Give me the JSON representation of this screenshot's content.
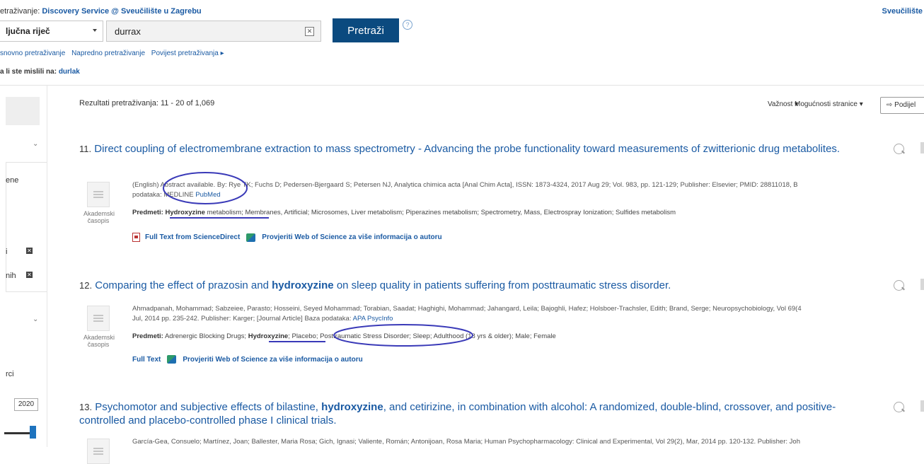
{
  "header": {
    "searching_label": "etraživanje:",
    "searching_value": "Discovery Service @ Sveučilište u Zagrebu",
    "institution": "Sveučilište",
    "field_select": "ljučna riječ",
    "query": "durrax",
    "search_button": "Pretraži",
    "help": "?",
    "nav": [
      "snovno pretraživanje",
      "Napredno pretraživanje",
      "Povijest pretraživanja ▸"
    ],
    "did_you_mean_label": "a li ste mislili na:",
    "did_you_mean_value": "durlak"
  },
  "sidebar": {
    "label_ene": "ene",
    "label_i": "i",
    "label_nih": "nih",
    "label_rci": "rci",
    "year": "2020",
    "remove": "✕"
  },
  "results": {
    "summary": "Rezultati pretraživanja: 11 - 20 of 1,069",
    "sort": "Važnost ▾",
    "page_options": "Mogućnosti stranice ▾",
    "share": "Podijel",
    "records": [
      {
        "number": "11.",
        "title": "Direct coupling of electromembrane extraction to mass spectrometry - Advancing the probe functionality toward measurements of zwitterionic drug metabolites.",
        "meta_line1": "(English) Abstract available. By: Rye TK; Fuchs D; Pedersen-Bjergaard S; Petersen NJ, Analytica chimica acta [Anal Chim Acta], ISSN: 1873-4324, 2017 Aug 29; Vol. 983, pp. 121-129; Publisher: Elsevier; PMID: 28811018, B",
        "meta_line2_prefix": "podataka: MEDLINE",
        "db": "PubMed",
        "subjects_label": "Predmeti:",
        "subjects_hl": "Hydroxyzine",
        "subjects_rest": " metabolism; Membranes, Artificial; Microsomes, Liver metabolism; Piperazines metabolism; Spectrometry, Mass, Electrospray Ionization; Sulfides metabolism",
        "type_label1": "Akademski",
        "type_label2": "časopis",
        "link1": "Full Text from ScienceDirect",
        "link2": "Provjeriti Web of Science za više informacija o autoru"
      },
      {
        "number": "12.",
        "title_pre": "Comparing the effect of prazosin and ",
        "title_hl": "hydroxyzine",
        "title_post": " on sleep quality in patients suffering from posttraumatic stress disorder.",
        "meta_line1": "Ahmadpanah, Mohammad; Sabzeiee, Parasto; Hosseini, Seyed Mohammad; Torabian, Saadat; Haghighi, Mohammad; Jahangard, Leila; Bajoghli, Hafez; Holsboer-Trachsler, Edith; Brand, Serge; Neuropsychobiology, Vol 69(4",
        "meta_line2_prefix": "Jul, 2014 pp. 235-242. Publisher: Karger; [Journal Article] Baza podataka:",
        "db": "APA PsycInfo",
        "subjects_label": "Predmeti:",
        "subjects_pre": " Adrenergic Blocking Drugs; ",
        "subjects_hl": "Hydroxyzine",
        "subjects_rest": "; Placebo; Posttraumatic Stress Disorder; Sleep; Adulthood (18 yrs & older); Male; Female",
        "type_label1": "Akademski",
        "type_label2": "časopis",
        "link1": "Full Text",
        "link2": "Provjeriti Web of Science za više informacija o autoru"
      },
      {
        "number": "13.",
        "title_pre": "Psychomotor and subjective effects of bilastine, ",
        "title_hl": "hydroxyzine",
        "title_post": ", and cetirizine, in combination with alcohol: A randomized, double-blind, crossover, and positive-controlled and placebo-controlled phase I clinical trials.",
        "meta_line1": "García-Gea, Consuelo; Martínez, Joan; Ballester, Maria Rosa; Gich, Ignasi; Valiente, Román; Antonijoan, Rosa Maria; Human Psychopharmacology: Clinical and Experimental, Vol 29(2), Mar, 2014 pp. 120-132. Publisher: Joh"
      }
    ]
  },
  "colors": {
    "primary_button": "#0b4a7f",
    "link": "#1a5aa3",
    "annotation": "#3a3ab8"
  }
}
